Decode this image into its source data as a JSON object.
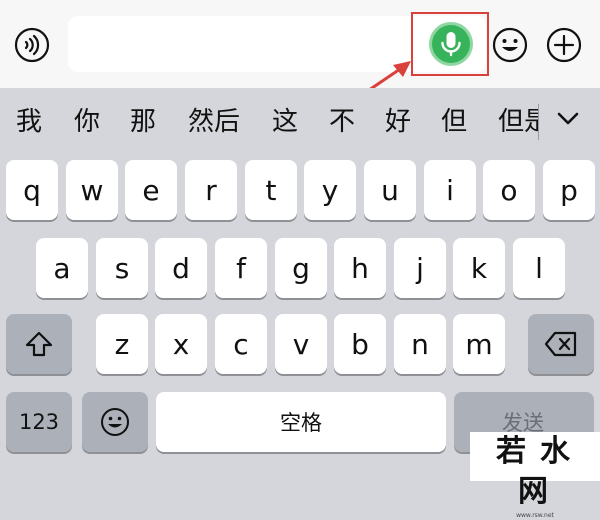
{
  "input_bar": {
    "voice_mode_icon": "voice-waves-icon",
    "mic_icon": "microphone-icon",
    "emoji_icon": "smiley-face-icon",
    "add_icon": "plus-circle-icon",
    "highlight_color": "#d9413a",
    "mic_color": "#37b35b"
  },
  "candidates": [
    "我",
    "你",
    "那",
    "然后",
    "这",
    "不",
    "好",
    "但",
    "但是"
  ],
  "candidate_expand_icon": "chevron-down-icon",
  "keyboard": {
    "row1": [
      "q",
      "w",
      "e",
      "r",
      "t",
      "y",
      "u",
      "i",
      "o",
      "p"
    ],
    "row2": [
      "a",
      "s",
      "d",
      "f",
      "g",
      "h",
      "j",
      "k",
      "l"
    ],
    "row3": [
      "z",
      "x",
      "c",
      "v",
      "b",
      "n",
      "m"
    ],
    "shift_icon": "shift-arrow-icon",
    "delete_icon": "backspace-icon",
    "numbers_label": "123",
    "emoji_icon": "smiley-face-icon",
    "space_label": "空格",
    "send_label": "发送"
  },
  "watermark": {
    "text": "若水网"
  }
}
